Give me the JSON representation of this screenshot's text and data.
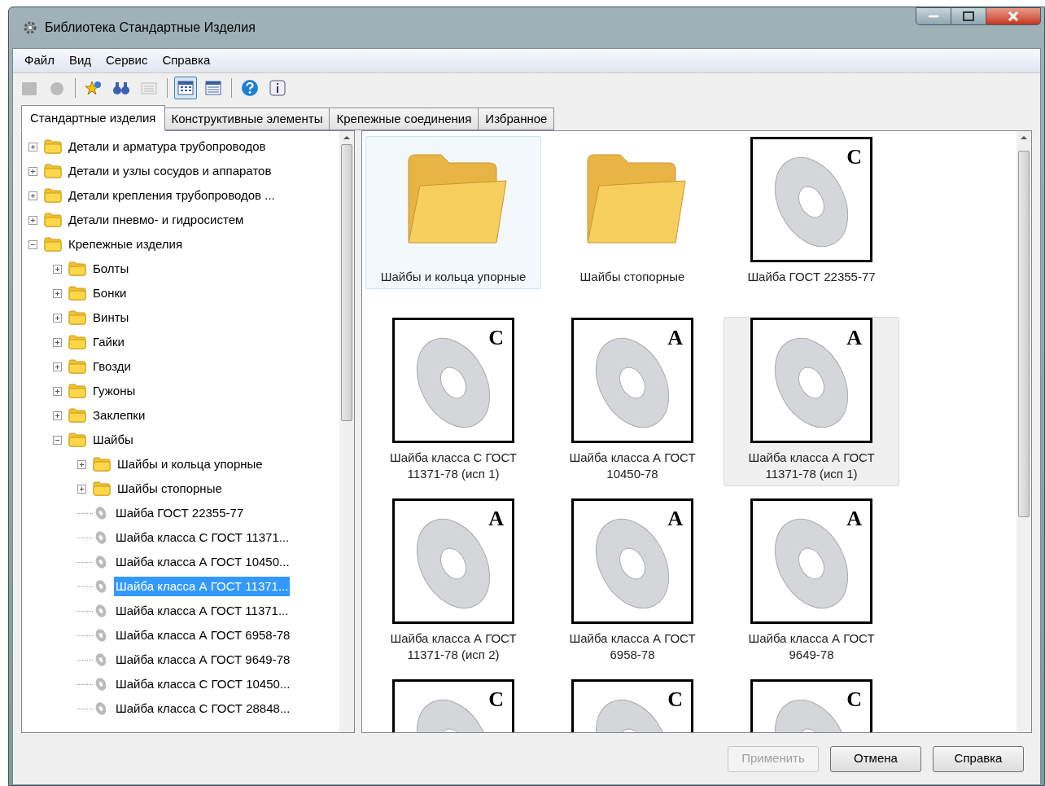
{
  "window": {
    "title": "Библиотека Стандартные Изделия"
  },
  "menu": [
    "Файл",
    "Вид",
    "Сервис",
    "Справка"
  ],
  "toolbar": [
    {
      "kind": "button",
      "disabled": true,
      "pressed": false
    },
    {
      "kind": "button",
      "disabled": true,
      "pressed": false
    },
    {
      "kind": "separator"
    },
    {
      "kind": "button",
      "disabled": false,
      "pressed": false
    },
    {
      "kind": "button",
      "disabled": false,
      "pressed": false
    },
    {
      "kind": "button",
      "disabled": true,
      "pressed": false
    },
    {
      "kind": "separator"
    },
    {
      "kind": "button",
      "disabled": false,
      "pressed": true
    },
    {
      "kind": "button",
      "disabled": false,
      "pressed": false
    },
    {
      "kind": "separator"
    },
    {
      "kind": "button",
      "disabled": false,
      "pressed": false
    },
    {
      "kind": "button",
      "disabled": false,
      "pressed": false
    }
  ],
  "tabs": [
    {
      "label": "Стандартные изделия",
      "selected": true
    },
    {
      "label": "Конструктивные элементы",
      "selected": false
    },
    {
      "label": "Крепежные соединения",
      "selected": false
    },
    {
      "label": "Избранное",
      "selected": false
    }
  ],
  "tree": [
    {
      "label": "Детали и арматура трубопроводов",
      "kind": "folder",
      "expanded": false,
      "selected": false
    },
    {
      "label": "Детали и узлы сосудов и аппаратов",
      "kind": "folder",
      "expanded": false,
      "selected": false
    },
    {
      "label": "Детали крепления трубопроводов ...",
      "kind": "folder",
      "expanded": false,
      "selected": false
    },
    {
      "label": "Детали пневмо- и гидросистем",
      "kind": "folder",
      "expanded": false,
      "selected": false
    },
    {
      "label": "Крепежные изделия",
      "kind": "folder",
      "expanded": true,
      "selected": false,
      "children": [
        {
          "label": "Болты",
          "kind": "folder",
          "expanded": false,
          "selected": false
        },
        {
          "label": "Бонки",
          "kind": "folder",
          "expanded": false,
          "selected": false
        },
        {
          "label": "Винты",
          "kind": "folder",
          "expanded": false,
          "selected": false
        },
        {
          "label": "Гайки",
          "kind": "folder",
          "expanded": false,
          "selected": false
        },
        {
          "label": "Гвозди",
          "kind": "folder",
          "expanded": false,
          "selected": false
        },
        {
          "label": "Гужоны",
          "kind": "folder",
          "expanded": false,
          "selected": false
        },
        {
          "label": "Заклепки",
          "kind": "folder",
          "expanded": false,
          "selected": false
        },
        {
          "label": "Шайбы",
          "kind": "folder",
          "expanded": true,
          "selected": false,
          "children": [
            {
              "label": "Шайбы и кольца упорные",
              "kind": "folder",
              "expanded": false,
              "selected": false
            },
            {
              "label": "Шайбы стопорные",
              "kind": "folder",
              "expanded": false,
              "selected": false
            },
            {
              "label": "Шайба ГОСТ 22355-77",
              "kind": "part",
              "selected": false
            },
            {
              "label": "Шайба класса С ГОСТ 11371...",
              "kind": "part",
              "selected": false
            },
            {
              "label": "Шайба класса А ГОСТ 10450...",
              "kind": "part",
              "selected": false
            },
            {
              "label": "Шайба класса А ГОСТ 11371...",
              "kind": "part",
              "selected": true
            },
            {
              "label": "Шайба класса А ГОСТ 11371...",
              "kind": "part",
              "selected": false
            },
            {
              "label": "Шайба класса А ГОСТ 6958-78",
              "kind": "part",
              "selected": false
            },
            {
              "label": "Шайба класса А ГОСТ 9649-78",
              "kind": "part",
              "selected": false
            },
            {
              "label": "Шайба класса С ГОСТ 10450...",
              "kind": "part",
              "selected": false
            },
            {
              "label": "Шайба класса С ГОСТ 28848...",
              "kind": "part",
              "selected": false
            }
          ]
        }
      ]
    }
  ],
  "items": [
    {
      "kind": "folder",
      "label": "Шайбы и кольца упорные",
      "selected": false,
      "focused": true
    },
    {
      "kind": "folder",
      "label": "Шайбы стопорные",
      "selected": false,
      "focused": false
    },
    {
      "kind": "part",
      "letter": "C",
      "label": "Шайба ГОСТ 22355-77",
      "selected": false,
      "focused": false
    },
    {
      "kind": "part",
      "letter": "C",
      "label": "Шайба класса С ГОСТ 11371-78 (исп 1)",
      "selected": false,
      "focused": false
    },
    {
      "kind": "part",
      "letter": "A",
      "label": "Шайба класса А ГОСТ 10450-78",
      "selected": false,
      "focused": false
    },
    {
      "kind": "part",
      "letter": "A",
      "label": "Шайба класса А ГОСТ 11371-78 (исп 1)",
      "selected": true,
      "focused": false
    },
    {
      "kind": "part",
      "letter": "A",
      "label": "Шайба класса А ГОСТ 11371-78 (исп 2)",
      "selected": false,
      "focused": false
    },
    {
      "kind": "part",
      "letter": "A",
      "label": "Шайба класса А ГОСТ 6958-78",
      "selected": false,
      "focused": false
    },
    {
      "kind": "part",
      "letter": "A",
      "label": "Шайба класса А ГОСТ 9649-78",
      "selected": false,
      "focused": false
    },
    {
      "kind": "part",
      "letter": "C",
      "selected": false,
      "focused": false
    },
    {
      "kind": "part",
      "letter": "C",
      "selected": false,
      "focused": false
    },
    {
      "kind": "part",
      "letter": "C",
      "selected": false,
      "focused": false
    }
  ],
  "buttons": [
    {
      "label": "Применить",
      "disabled": true
    },
    {
      "label": "Отмена",
      "disabled": false
    },
    {
      "label": "Справка",
      "disabled": false
    }
  ]
}
